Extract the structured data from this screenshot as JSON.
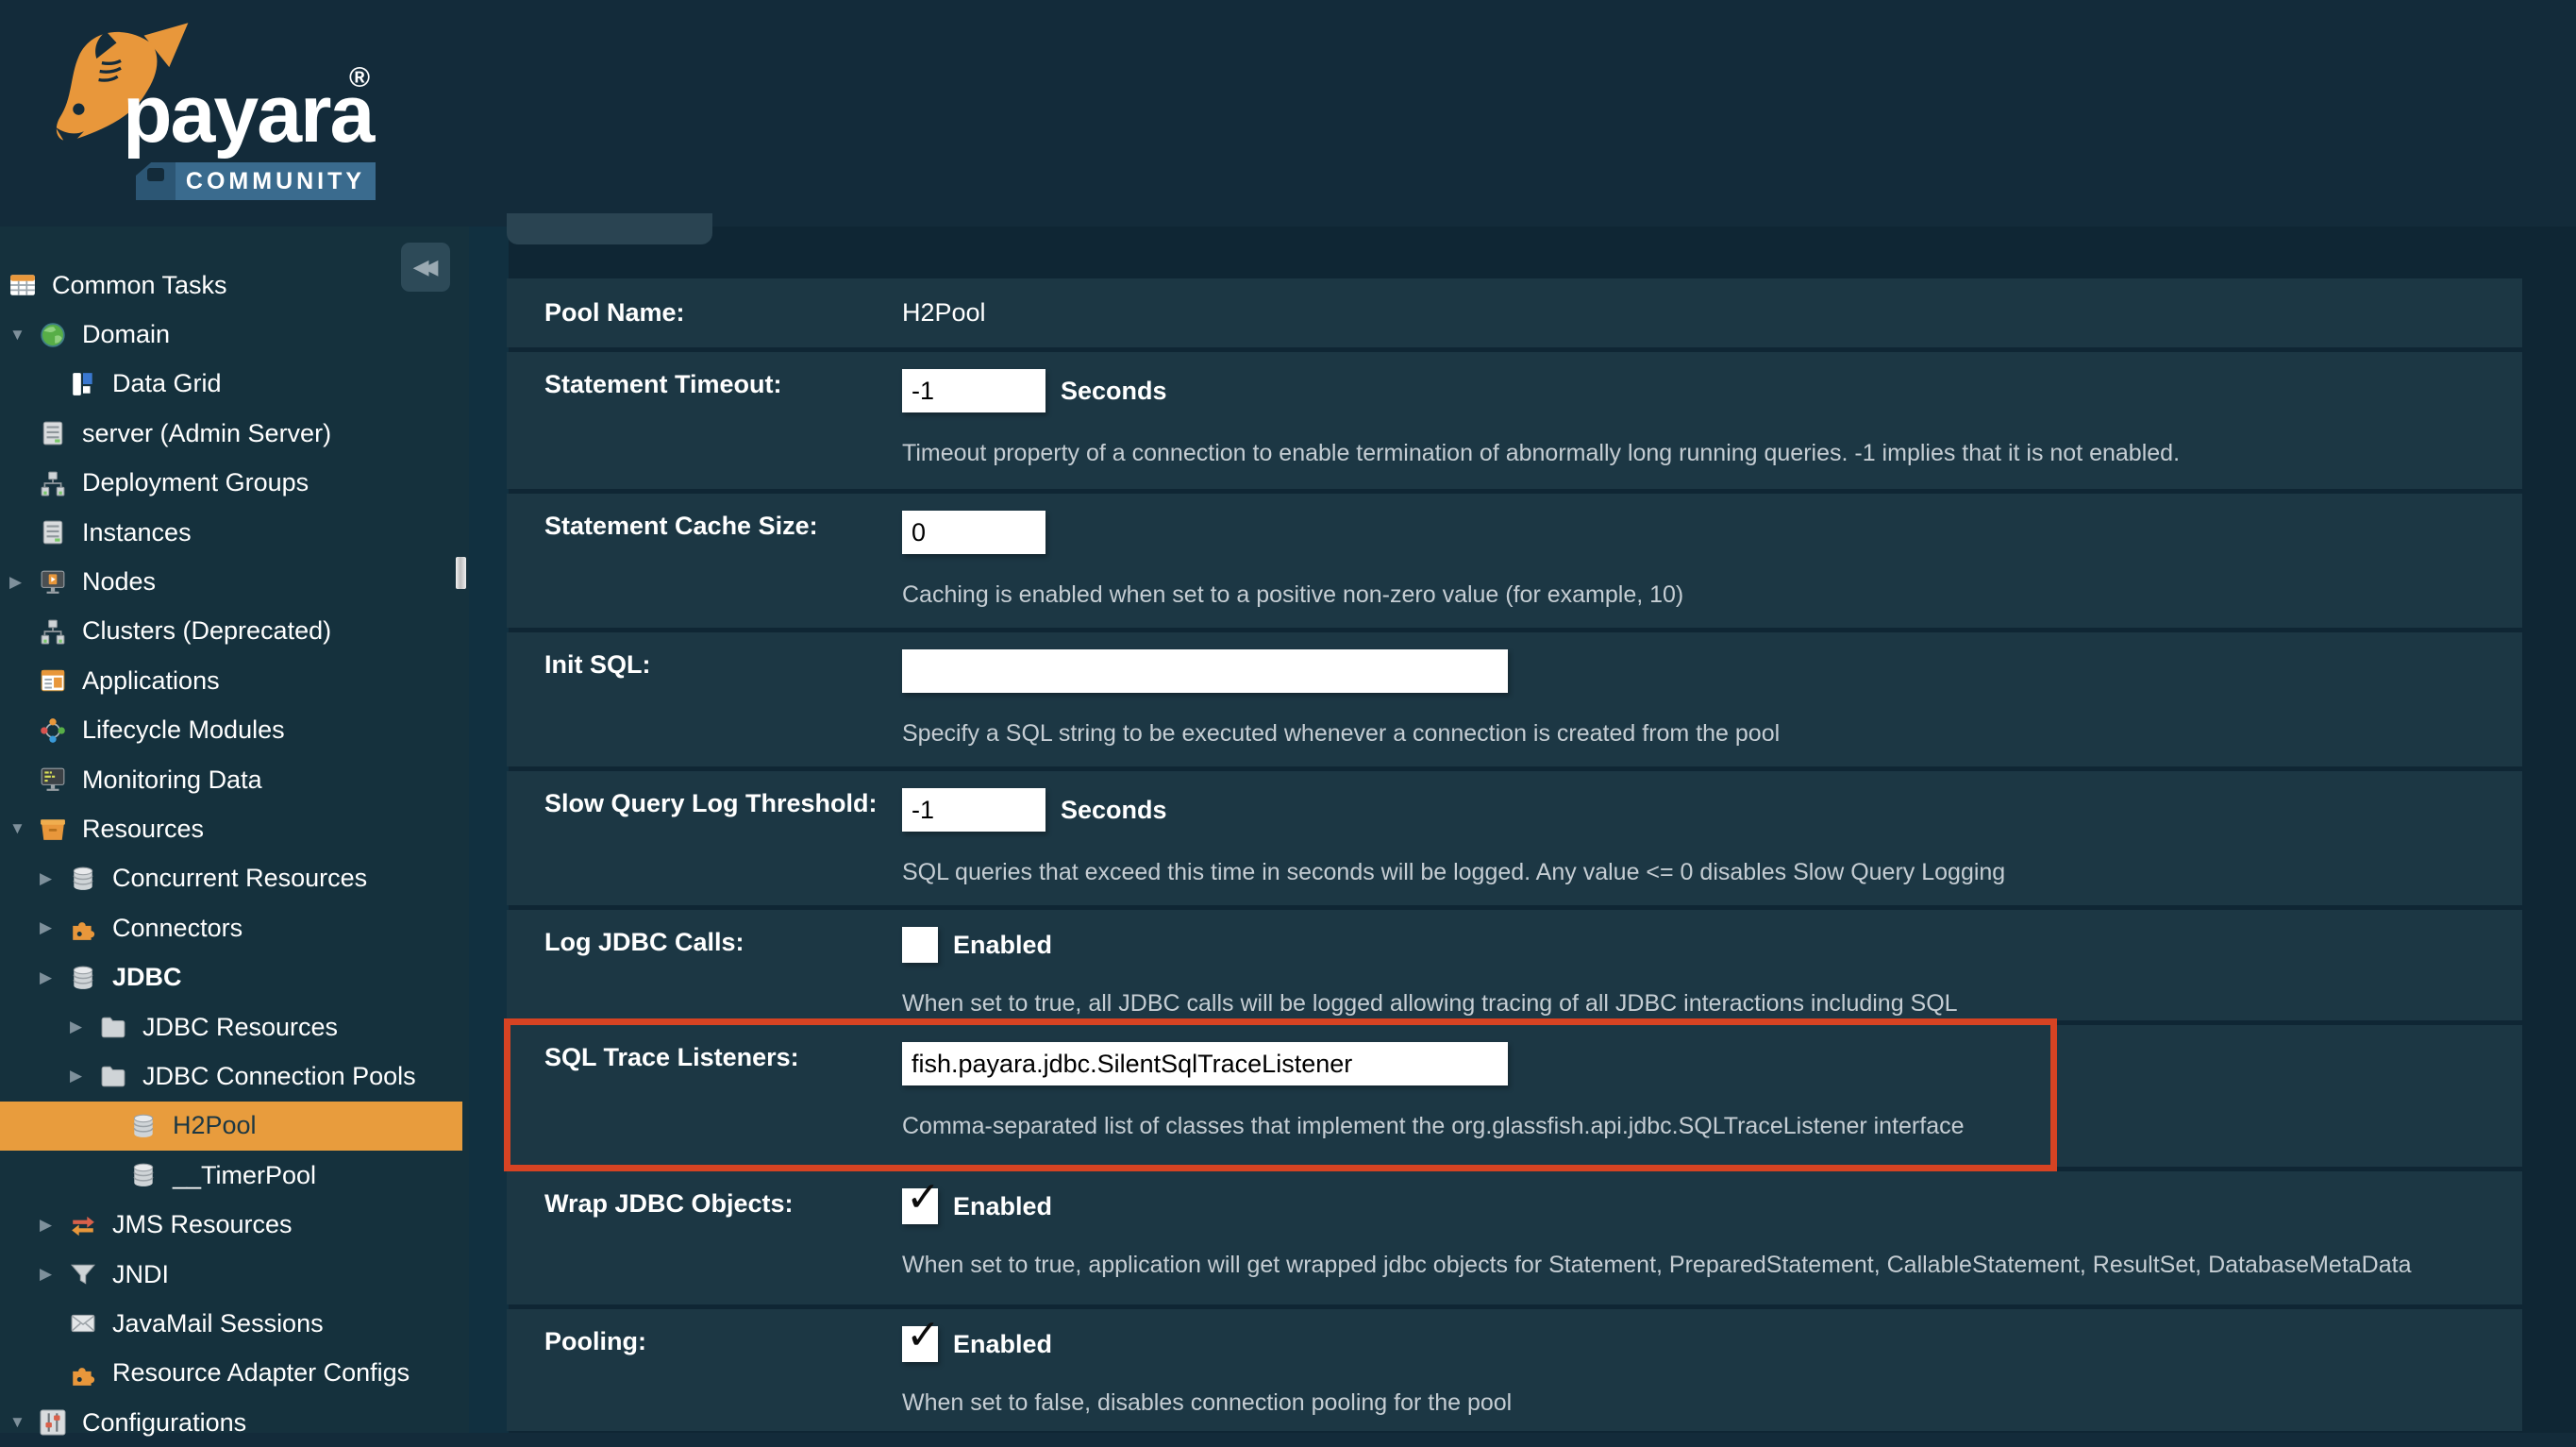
{
  "brand": {
    "name": "payara",
    "registered": "®",
    "community_label": "COMMUNITY",
    "accent_orange": "#e8973b",
    "badge_blue": "#3a6b8e"
  },
  "colors": {
    "header_bg": "#132b3a",
    "sidebar_bg": "#15313d",
    "main_bg": "#0f2634",
    "row_bg": "#1c3744",
    "selected_row_bg": "#e89c3d",
    "highlight_border": "#d64323",
    "help_text": "#c5cdd3"
  },
  "sidebar": {
    "collapse_icon": "chevrons-left",
    "items": [
      {
        "label": "Common Tasks",
        "icon": "tasks",
        "indent": 0,
        "expander": null,
        "variant": "root"
      },
      {
        "label": "Domain",
        "icon": "globe",
        "indent": 0,
        "expander": "down"
      },
      {
        "label": "Data Grid",
        "icon": "datagrid",
        "indent": 1,
        "expander": null
      },
      {
        "label": "server (Admin Server)",
        "icon": "server",
        "indent": 0,
        "expander": null
      },
      {
        "label": "Deployment Groups",
        "icon": "network",
        "indent": 0,
        "expander": null
      },
      {
        "label": "Instances",
        "icon": "server",
        "indent": 0,
        "expander": null
      },
      {
        "label": "Nodes",
        "icon": "monitor",
        "indent": 0,
        "expander": "right"
      },
      {
        "label": "Clusters (Deprecated)",
        "icon": "network",
        "indent": 0,
        "expander": null
      },
      {
        "label": "Applications",
        "icon": "window",
        "indent": 0,
        "expander": null
      },
      {
        "label": "Lifecycle Modules",
        "icon": "lifecycle",
        "indent": 0,
        "expander": null
      },
      {
        "label": "Monitoring Data",
        "icon": "monitor-dark",
        "indent": 0,
        "expander": null
      },
      {
        "label": "Resources",
        "icon": "box",
        "indent": 0,
        "expander": "down"
      },
      {
        "label": "Concurrent Resources",
        "icon": "database",
        "indent": 1,
        "expander": "right"
      },
      {
        "label": "Connectors",
        "icon": "puzzle",
        "indent": 1,
        "expander": "right"
      },
      {
        "label": "JDBC",
        "icon": "database",
        "indent": 1,
        "expander": "right",
        "bold": true
      },
      {
        "label": "JDBC Resources",
        "icon": "folder",
        "indent": 2,
        "expander": "right"
      },
      {
        "label": "JDBC Connection Pools",
        "icon": "folder",
        "indent": 2,
        "expander": "right"
      },
      {
        "label": "H2Pool",
        "icon": "database",
        "indent": 3,
        "expander": null,
        "selected": true
      },
      {
        "label": "__TimerPool",
        "icon": "database",
        "indent": 3,
        "expander": null
      },
      {
        "label": "JMS Resources",
        "icon": "jms-arrows",
        "indent": 1,
        "expander": "right"
      },
      {
        "label": "JNDI",
        "icon": "funnel",
        "indent": 1,
        "expander": "right"
      },
      {
        "label": "JavaMail Sessions",
        "icon": "mail",
        "indent": 1,
        "expander": null
      },
      {
        "label": "Resource Adapter Configs",
        "icon": "puzzle",
        "indent": 1,
        "expander": null
      },
      {
        "label": "Configurations",
        "icon": "sliders",
        "indent": 0,
        "expander": "down"
      }
    ]
  },
  "main": {
    "form": {
      "rows": [
        {
          "label": "Pool Name:",
          "type": "static",
          "value": "H2Pool"
        },
        {
          "label": "Statement Timeout:",
          "type": "text",
          "value": "-1",
          "size": "small",
          "suffix": "Seconds",
          "help": "Timeout property of a connection to enable termination of abnormally long running queries. -1 implies that it is not enabled."
        },
        {
          "label": "Statement Cache Size:",
          "type": "text",
          "value": "0",
          "size": "small",
          "suffix": "",
          "help": "Caching is enabled when set to a positive non-zero value (for example, 10)"
        },
        {
          "label": "Init SQL:",
          "type": "text",
          "value": "",
          "size": "large",
          "suffix": "",
          "help": "Specify a SQL string to be executed whenever a connection is created from the pool"
        },
        {
          "label": "Slow Query Log Threshold:",
          "type": "text",
          "value": "-1",
          "size": "small",
          "suffix": "Seconds",
          "help": "SQL queries that exceed this time in seconds will be logged. Any value <= 0 disables Slow Query Logging"
        },
        {
          "label": "Log JDBC Calls:",
          "type": "checkbox",
          "checked": false,
          "suffix": "Enabled",
          "help": "When set to true, all JDBC calls will be logged allowing tracing of all JDBC interactions including SQL"
        },
        {
          "label": "SQL Trace Listeners:",
          "type": "text",
          "value": "fish.payara.jdbc.SilentSqlTraceListener",
          "size": "large",
          "suffix": "",
          "help": "Comma-separated list of classes that implement the org.glassfish.api.jdbc.SQLTraceListener interface",
          "highlighted": true
        },
        {
          "label": "Wrap JDBC Objects:",
          "type": "checkbox",
          "checked": true,
          "suffix": "Enabled",
          "help": "When set to true, application will get wrapped jdbc objects for Statement, PreparedStatement, CallableStatement, ResultSet, DatabaseMetaData"
        },
        {
          "label": "Pooling:",
          "type": "checkbox",
          "checked": true,
          "suffix": "Enabled",
          "help": "When set to false, disables connection pooling for the pool"
        }
      ]
    }
  }
}
